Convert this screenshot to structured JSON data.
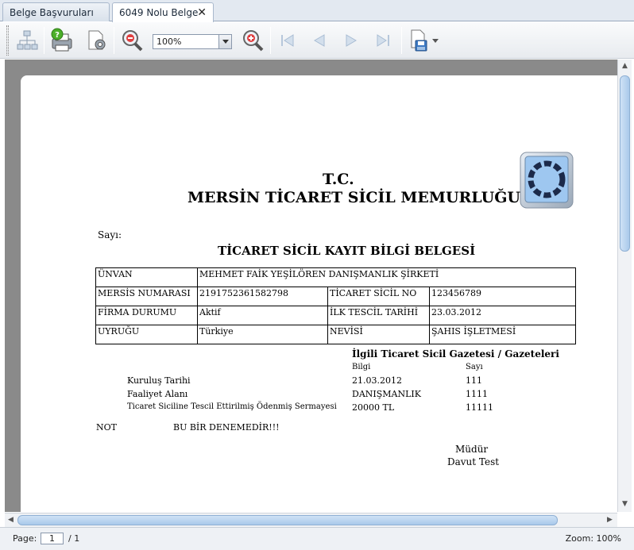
{
  "tabs": [
    {
      "label": "Belge Başvuruları"
    },
    {
      "label": "6049 Nolu Belge",
      "close": "✕"
    }
  ],
  "toolbar": {
    "zoom_value": "100%",
    "icons": [
      "document-map-icon",
      "help-print-icon",
      "page-setup-icon",
      "zoom-out-icon",
      "zoom-in-icon",
      "first-page-icon",
      "previous-page-icon",
      "next-page-icon",
      "last-page-icon",
      "save-icon",
      "dropdown-arrow-icon"
    ]
  },
  "document": {
    "header_line1": "T.C.",
    "header_line2": "MERSİN TİCARET SİCİL MEMURLUĞU",
    "sayi_label": "Sayı:",
    "title": "TİCARET SİCİL KAYIT BİLGİ BELGESİ",
    "rows": [
      {
        "k1": "ÜNVAN",
        "v1": "MEHMET FAİK YEŞİLÖREN DANIŞMANLIK ŞİRKETİ"
      },
      {
        "k1": "MERSİS NUMARASI",
        "v1": "2191752361582798",
        "k2": "TİCARET SİCİL NO",
        "v2": "123456789"
      },
      {
        "k1": "FİRMA DURUMU",
        "v1": "Aktif",
        "k2": "İLK TESCİL TARİHİ",
        "v2": "23.03.2012"
      },
      {
        "k1": "UYRUĞU",
        "v1": "Türkiye",
        "k2": "NEVİSİ",
        "v2": "ŞAHIS İŞLETMESİ"
      }
    ],
    "gazette_heading": "İlgili Ticaret Sicil Gazetesi / Gazeteleri",
    "gazette_columns": [
      "Bilgi",
      "Sayı"
    ],
    "gazette_rows": [
      {
        "label": "Kuruluş Tarihi",
        "bilgi": "21.03.2012",
        "sayi": "111"
      },
      {
        "label": "Faaliyet Alanı",
        "bilgi": "DANIŞMANLIK",
        "sayi": "1111"
      },
      {
        "label": "Ticaret Siciline Tescil Ettirilmiş Ödenmiş Sermayesi",
        "bilgi": "20000 TL",
        "sayi": "11111"
      }
    ],
    "note_label": "NOT",
    "note_text": "BU BİR DENEMEDİR!!!",
    "signer_title": "Müdür",
    "signer_name": "Davut Test"
  },
  "status": {
    "page_label": "Page:",
    "page_value": "1",
    "page_total": "/ 1",
    "zoom_text": "Zoom: 100%"
  },
  "colors": {
    "accent": "#a9c9ea",
    "viewer_bg": "#8a8a8a"
  }
}
